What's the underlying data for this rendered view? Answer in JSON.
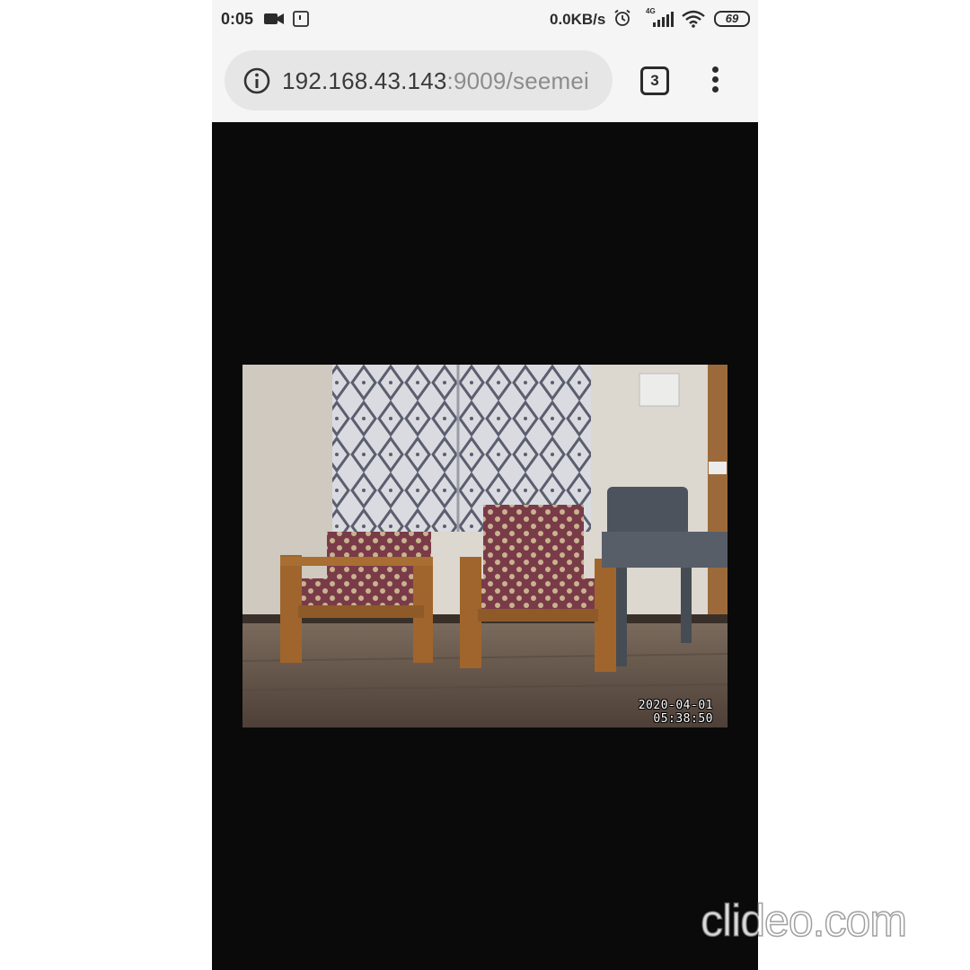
{
  "status_bar": {
    "time": "0:05",
    "network_speed": "0.0KB/s",
    "network_type": "4G",
    "battery": "69",
    "icons": [
      "video-camera-icon",
      "sim-card-icon",
      "alarm-icon",
      "signal-icon",
      "wifi-icon",
      "battery-icon"
    ]
  },
  "browser": {
    "url_host": "192.168.43.143",
    "url_rest": ":9009/seemei",
    "tab_count": "3",
    "icons": [
      "info-icon",
      "tabs-icon",
      "overflow-menu-icon"
    ]
  },
  "camera": {
    "date": "2020-04-01",
    "time": "05:38:50"
  },
  "watermark": "clideo.com"
}
